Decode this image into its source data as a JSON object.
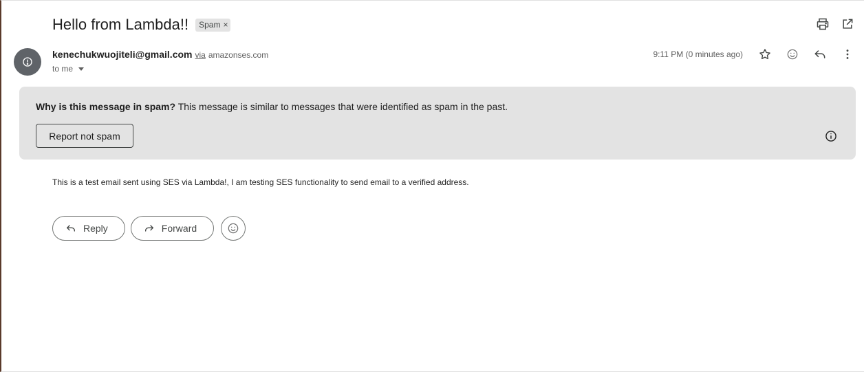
{
  "message": {
    "subject": "Hello from Lambda!!",
    "label_chip": "Spam",
    "label_chip_remove": "×",
    "sender_email": "kenechukwuojiteli@gmail.com",
    "via_text": "via",
    "via_domain": "amazonses.com",
    "recipient_text": "to me",
    "timestamp": "9:11 PM (0 minutes ago)",
    "body": "This is a test email sent using SES via Lambda!, I am testing SES functionality to send email to a verified address."
  },
  "spam_banner": {
    "question": "Why is this message in spam?",
    "explanation": " This message is similar to messages that were identified as spam in the past.",
    "report_button": "Report not spam"
  },
  "actions": {
    "reply_label": "Reply",
    "forward_label": "Forward"
  },
  "icons": {
    "top": [
      "print-icon",
      "open-in-new-window-icon"
    ],
    "header_row": [
      "star-icon",
      "emoji-icon",
      "reply-icon",
      "more-vert-icon"
    ],
    "avatar": "alert-circle-icon",
    "banner": "info-icon"
  },
  "colors": {
    "banner_bg": "#e3e3e3",
    "avatar_bg": "#5f6368",
    "text_primary": "#1f1f1f",
    "text_secondary": "#5e5e5e"
  }
}
